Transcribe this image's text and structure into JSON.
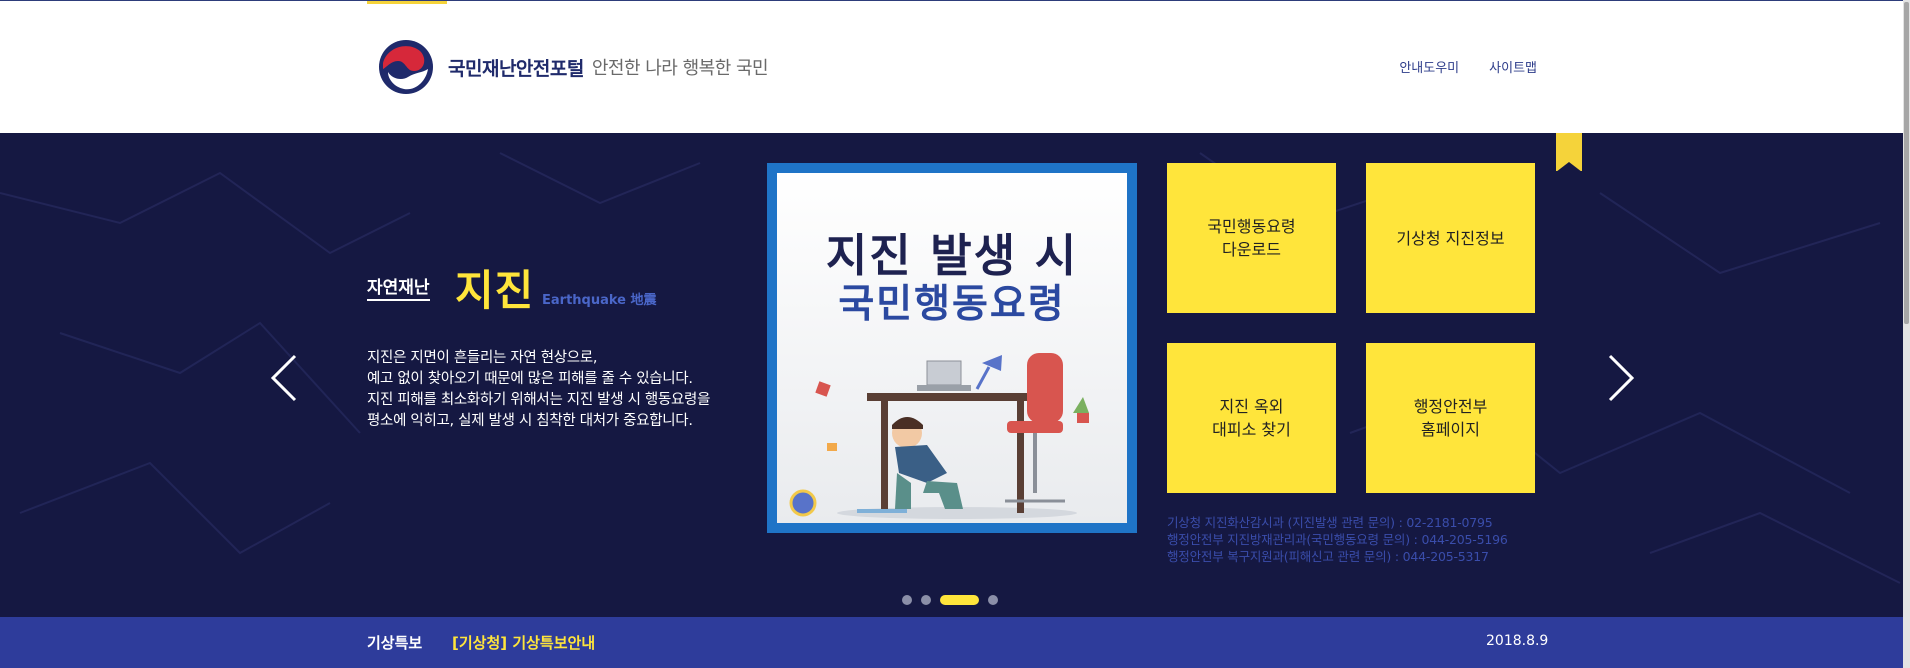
{
  "header": {
    "site_title": "국민재난안전포털",
    "slogan": "안전한 나라 행복한 국민",
    "util_links": [
      "안내도우미",
      "사이트맵"
    ]
  },
  "hero": {
    "category": "자연재난",
    "title": "지진",
    "title_en": "Earthquake 地震",
    "description": [
      "지진은 지면이 흔들리는 자연 현상으로,",
      "예고 없이 찾아오기 때문에 많은 피해를 줄 수 있습니다.",
      "지진 피해를 최소화하기 위해서는 지진 발생 시 행동요령을",
      "평소에 익히고, 실제 발생 시 침착한 대처가 중요합니다."
    ],
    "poster": {
      "line1": "지진 발생 시",
      "line2": "국민행동요령"
    },
    "tiles": [
      {
        "line1": "국민행동요령",
        "line2": "다운로드"
      },
      {
        "line1": "기상청 지진정보",
        "line2": ""
      },
      {
        "line1": "지진 옥외",
        "line2": "대피소 찾기"
      },
      {
        "line1": "행정안전부",
        "line2": "홈페이지"
      }
    ],
    "contacts": [
      "기상청 지진화산감시과 (지진발생 관련 문의) :  02-2181-0795",
      "행정안전부 지진방재관리과(국민행동요령 문의) :  044-205-5196",
      "행정안전부 복구지원과(피해신고 관련 문의) :  044-205-5317"
    ],
    "slider": {
      "total": 4,
      "active_index": 2
    },
    "icons": {
      "prev": "chevron-left-icon",
      "next": "chevron-right-icon"
    }
  },
  "bottom_bar": {
    "label": "기상특보",
    "link": "[기상청] 기상특보안내",
    "date": "2018.8.9"
  },
  "colors": {
    "navy": "#151842",
    "accent_yellow": "#ffe53b",
    "bar_blue": "#2e3c9b",
    "poster_frame": "#1f74c7"
  }
}
